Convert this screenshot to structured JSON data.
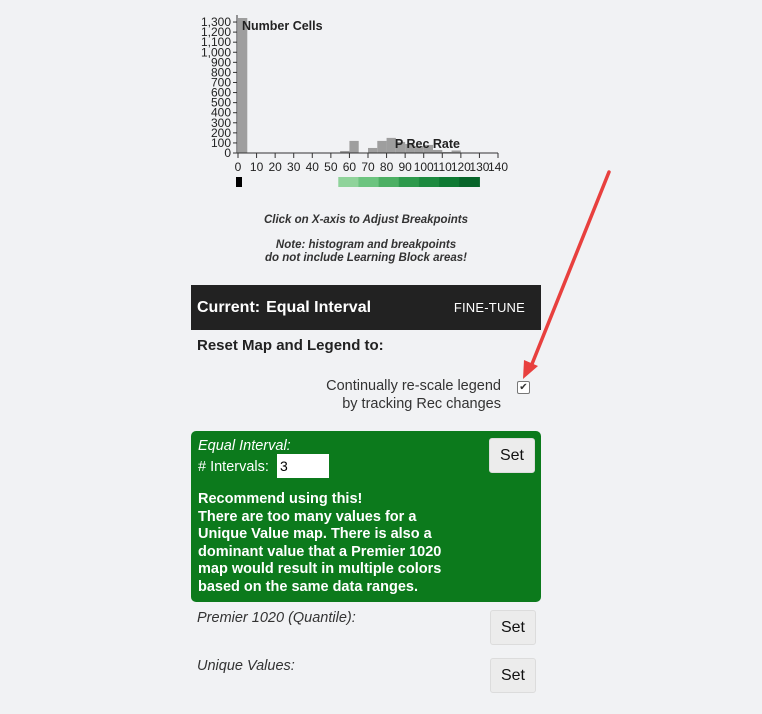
{
  "histogram": {
    "title": "Number Cells",
    "x_title": "P Rec Rate",
    "y_ticks": [
      "1,300",
      "1,200",
      "1,100",
      "1,000",
      "900",
      "800",
      "700",
      "600",
      "500",
      "400",
      "300",
      "200",
      "100",
      "0"
    ],
    "x_ticks": [
      "0",
      "10",
      "20",
      "30",
      "40",
      "50",
      "60",
      "70",
      "80",
      "90",
      "100",
      "110",
      "120",
      "130",
      "140"
    ],
    "colors": {
      "bars": "#9e9e9e",
      "legend": [
        "#8fd39a",
        "#6cc47f",
        "#4caf63",
        "#2e9a4c",
        "#1d8a3f",
        "#0f7a33",
        "#08652a"
      ]
    }
  },
  "chart_data": {
    "type": "bar",
    "title": "Number Cells",
    "xlabel": "P Rec Rate",
    "ylabel": "",
    "xlim": [
      0,
      140
    ],
    "ylim": [
      0,
      1350
    ],
    "bins": [
      {
        "x0": 0,
        "x1": 5,
        "value": 1340
      },
      {
        "x0": 55,
        "x1": 60,
        "value": 20
      },
      {
        "x0": 60,
        "x1": 65,
        "value": 120
      },
      {
        "x0": 65,
        "x1": 70,
        "value": 5
      },
      {
        "x0": 70,
        "x1": 75,
        "value": 50
      },
      {
        "x0": 75,
        "x1": 80,
        "value": 120
      },
      {
        "x0": 80,
        "x1": 85,
        "value": 150
      },
      {
        "x0": 85,
        "x1": 90,
        "value": 110
      },
      {
        "x0": 90,
        "x1": 95,
        "value": 90
      },
      {
        "x0": 95,
        "x1": 100,
        "value": 70
      },
      {
        "x0": 100,
        "x1": 105,
        "value": 80
      },
      {
        "x0": 105,
        "x1": 110,
        "value": 30
      },
      {
        "x0": 110,
        "x1": 115,
        "value": 10
      },
      {
        "x0": 115,
        "x1": 120,
        "value": 25
      }
    ]
  },
  "hints": {
    "click_axis": "Click on X-axis to Adjust Breakpoints",
    "note_line1": "Note: histogram and breakpoints",
    "note_line2": "do not include Learning Block areas!"
  },
  "current": {
    "label": "Current:",
    "method": "Equal Interval",
    "finetune": "FINE-TUNE"
  },
  "reset_title": "Reset Map and Legend to:",
  "rescale": {
    "line1": "Continually re-scale legend",
    "line2": "by tracking Rec changes",
    "checked": true
  },
  "equal_interval": {
    "title": "Equal Interval:",
    "intervals_label": "# Intervals:",
    "intervals_value": "3",
    "set_label": "Set",
    "recommend_lines": [
      "Recommend using this!",
      "There are too many values for a",
      "Unique Value map. There is also a",
      "dominant value that a Premier 1020",
      "map would result in multiple colors",
      "based on the same data ranges."
    ],
    "color": "#0c7a1c"
  },
  "premier": {
    "label": "Premier 1020 (Quantile):",
    "set_label": "Set"
  },
  "unique": {
    "label": "Unique Values:",
    "set_label": "Set"
  },
  "annotation": {
    "arrow_color": "#e8403e"
  }
}
